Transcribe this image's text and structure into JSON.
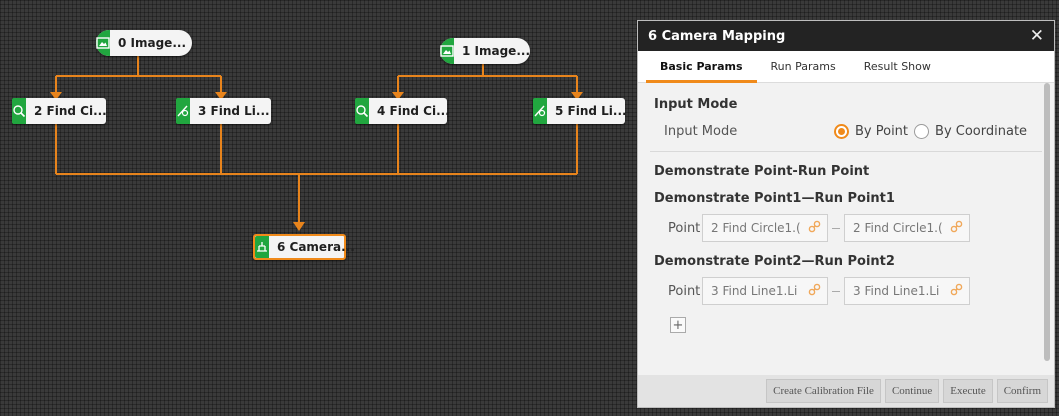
{
  "nodes": [
    {
      "id": "n0",
      "label": "0 Image...",
      "icon": "image-icon"
    },
    {
      "id": "n1",
      "label": "1 Image...",
      "icon": "image-icon"
    },
    {
      "id": "n2",
      "label": "2 Find Ci...",
      "icon": "find-circle-icon"
    },
    {
      "id": "n3",
      "label": "3 Find Li...",
      "icon": "find-line-icon"
    },
    {
      "id": "n4",
      "label": "4 Find Ci...",
      "icon": "find-circle-icon"
    },
    {
      "id": "n5",
      "label": "5 Find Li...",
      "icon": "find-line-icon"
    },
    {
      "id": "n6",
      "label": "6 Camera...",
      "icon": "camera-mapping-icon",
      "selected": true
    }
  ],
  "colors": {
    "accent": "#f08a1a",
    "node_icon_bg": "#21a63f",
    "wire": "#e8841c",
    "panel_header": "#232323"
  },
  "panel": {
    "title": "6 Camera Mapping",
    "close": "✕",
    "tabs": [
      "Basic Params",
      "Run Params",
      "Result Show"
    ],
    "active_tab": "Basic Params",
    "input_mode": {
      "section": "Input Mode",
      "label": "Input Mode",
      "options": [
        "By Point",
        "By Coordinate"
      ],
      "selected": "By Point"
    },
    "demo_section": "Demonstrate Point-Run Point",
    "pairs": [
      {
        "title": "Demonstrate Point1—Run Point1",
        "label": "Point",
        "demo_value": "2 Find Circle1.(",
        "run_value": "2 Find Circle1.("
      },
      {
        "title": "Demonstrate Point2—Run Point2",
        "label": "Point",
        "demo_value": "3 Find Line1.Li",
        "run_value": "3 Find Line1.Li"
      }
    ],
    "add_button": "+",
    "footer_buttons": [
      "Create Calibration File",
      "Continue",
      "Execute",
      "Confirm"
    ]
  }
}
